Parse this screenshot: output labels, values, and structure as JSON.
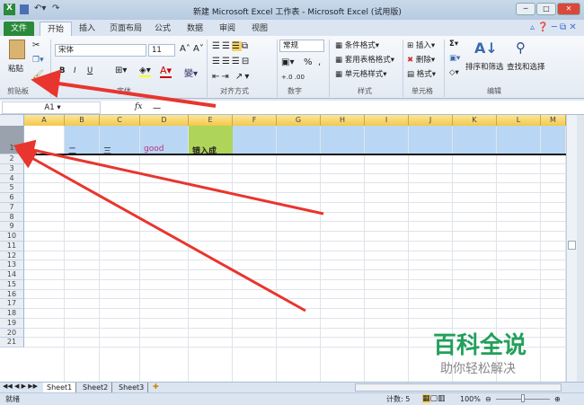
{
  "titlebar": {
    "title": "新建 Microsoft Excel 工作表 - Microsoft Excel (试用版)"
  },
  "tabs": [
    "文件",
    "开始",
    "插入",
    "页面布局",
    "公式",
    "数据",
    "审阅",
    "视图"
  ],
  "ribbon": {
    "clipboard": {
      "paste": "粘贴",
      "group": "剪贴板"
    },
    "font": {
      "name": "宋体",
      "size": "11",
      "bold": "B",
      "italic": "I",
      "underline": "U",
      "group": "字体"
    },
    "alignment": {
      "group": "对齐方式"
    },
    "number": {
      "format": "常规",
      "percent": "%",
      "comma": ",",
      "group": "数字"
    },
    "styles": {
      "cond": "条件格式",
      "table": "套用表格格式",
      "cell": "单元格样式",
      "group": "样式"
    },
    "cells": {
      "insert": "插入",
      "delete": "删除",
      "format": "格式",
      "group": "单元格"
    },
    "editing": {
      "sigma": "Σ",
      "sort": "排序和筛选",
      "find": "查找和选择",
      "group": "编辑"
    }
  },
  "formula_bar": {
    "name_box": "A1",
    "fx": "fx",
    "value": "一"
  },
  "columns": [
    "A",
    "B",
    "C",
    "D",
    "E",
    "F",
    "G",
    "H",
    "I",
    "J",
    "K",
    "L",
    "M"
  ],
  "rows": [
    "1",
    "2",
    "3",
    "4",
    "5",
    "6",
    "7",
    "8",
    "9",
    "10",
    "11",
    "12",
    "13",
    "14",
    "15",
    "16",
    "17",
    "18",
    "19",
    "20",
    "21"
  ],
  "row1": [
    "一",
    "二",
    "三",
    "good",
    "错入成"
  ],
  "sheets": [
    "Sheet1",
    "Sheet2",
    "Sheet3"
  ],
  "status": {
    "ready": "就绪",
    "count": "计数: 5",
    "zoom": "100%"
  },
  "watermark": {
    "line1": "百科全说",
    "line2": "助你轻松解决"
  },
  "colors": {
    "selection": "#b9d7f5",
    "e1": "#aed45a",
    "accent": "#e8352e",
    "file_tab": "#2a8a3a"
  }
}
